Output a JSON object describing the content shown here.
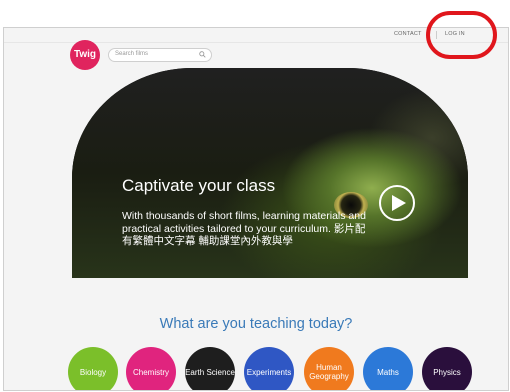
{
  "nav": {
    "contact": "CONTACT",
    "login": "LOG IN"
  },
  "header": {
    "logo": "Twig",
    "search_placeholder": "Search films"
  },
  "hero": {
    "title": "Captivate your class",
    "text": "With thousands of short films, learning materials and practical activities tailored to your curriculum. 影片配有繁體中文字幕 輔助課堂內外教與學"
  },
  "section": {
    "title": "What are you teaching today?"
  },
  "subjects": [
    {
      "label": "Biology",
      "color": "#7bbf2a"
    },
    {
      "label": "Chemistry",
      "color": "#e0247e"
    },
    {
      "label": "Earth Science",
      "color": "#1e1e1e"
    },
    {
      "label": "Experiments",
      "color": "#2f57c4"
    },
    {
      "label": "Human Geography",
      "color": "#f07a1e"
    },
    {
      "label": "Maths",
      "color": "#2c79d8"
    },
    {
      "label": "Physics",
      "color": "#2a0f3c"
    }
  ],
  "colors": {
    "logo": "#e0245e",
    "section_title": "#3a7ab8",
    "callout": "#e0161c"
  }
}
